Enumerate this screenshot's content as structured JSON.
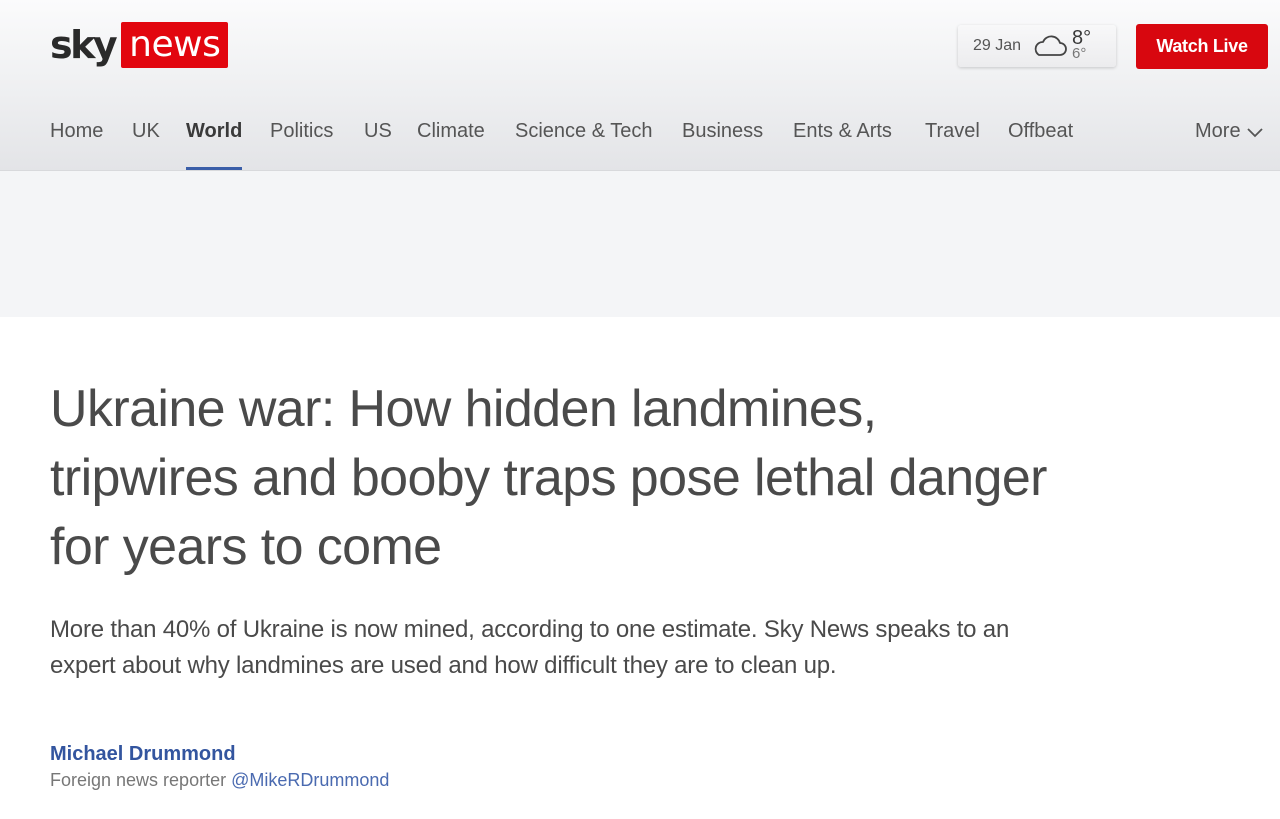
{
  "header": {
    "logo": {
      "sky": "sky",
      "news": "news"
    },
    "weather": {
      "date": "29 Jan",
      "icon": "cloud-icon",
      "high": "8°",
      "low": "6°"
    },
    "watch_live": "Watch Live",
    "colors": {
      "brand_red": "#e2060f",
      "active_nav": "#3a5ea8"
    }
  },
  "nav": {
    "items": [
      {
        "label": "Home"
      },
      {
        "label": "UK"
      },
      {
        "label": "World",
        "active": true
      },
      {
        "label": "Politics"
      },
      {
        "label": "US"
      },
      {
        "label": "Climate"
      },
      {
        "label": "Science & Tech"
      },
      {
        "label": "Business"
      },
      {
        "label": "Ents & Arts"
      },
      {
        "label": "Travel"
      },
      {
        "label": "Offbeat"
      }
    ],
    "more": "More"
  },
  "article": {
    "headline": "Ukraine war: How hidden landmines, tripwires and booby traps pose lethal danger for years to come",
    "standfirst": "More than 40% of Ukraine is now mined, according to one estimate. Sky News speaks to an expert about why landmines are used and how difficult they are to clean up.",
    "author": "Michael Drummond",
    "role": "Foreign news reporter",
    "handle": "@MikeRDrummond"
  }
}
